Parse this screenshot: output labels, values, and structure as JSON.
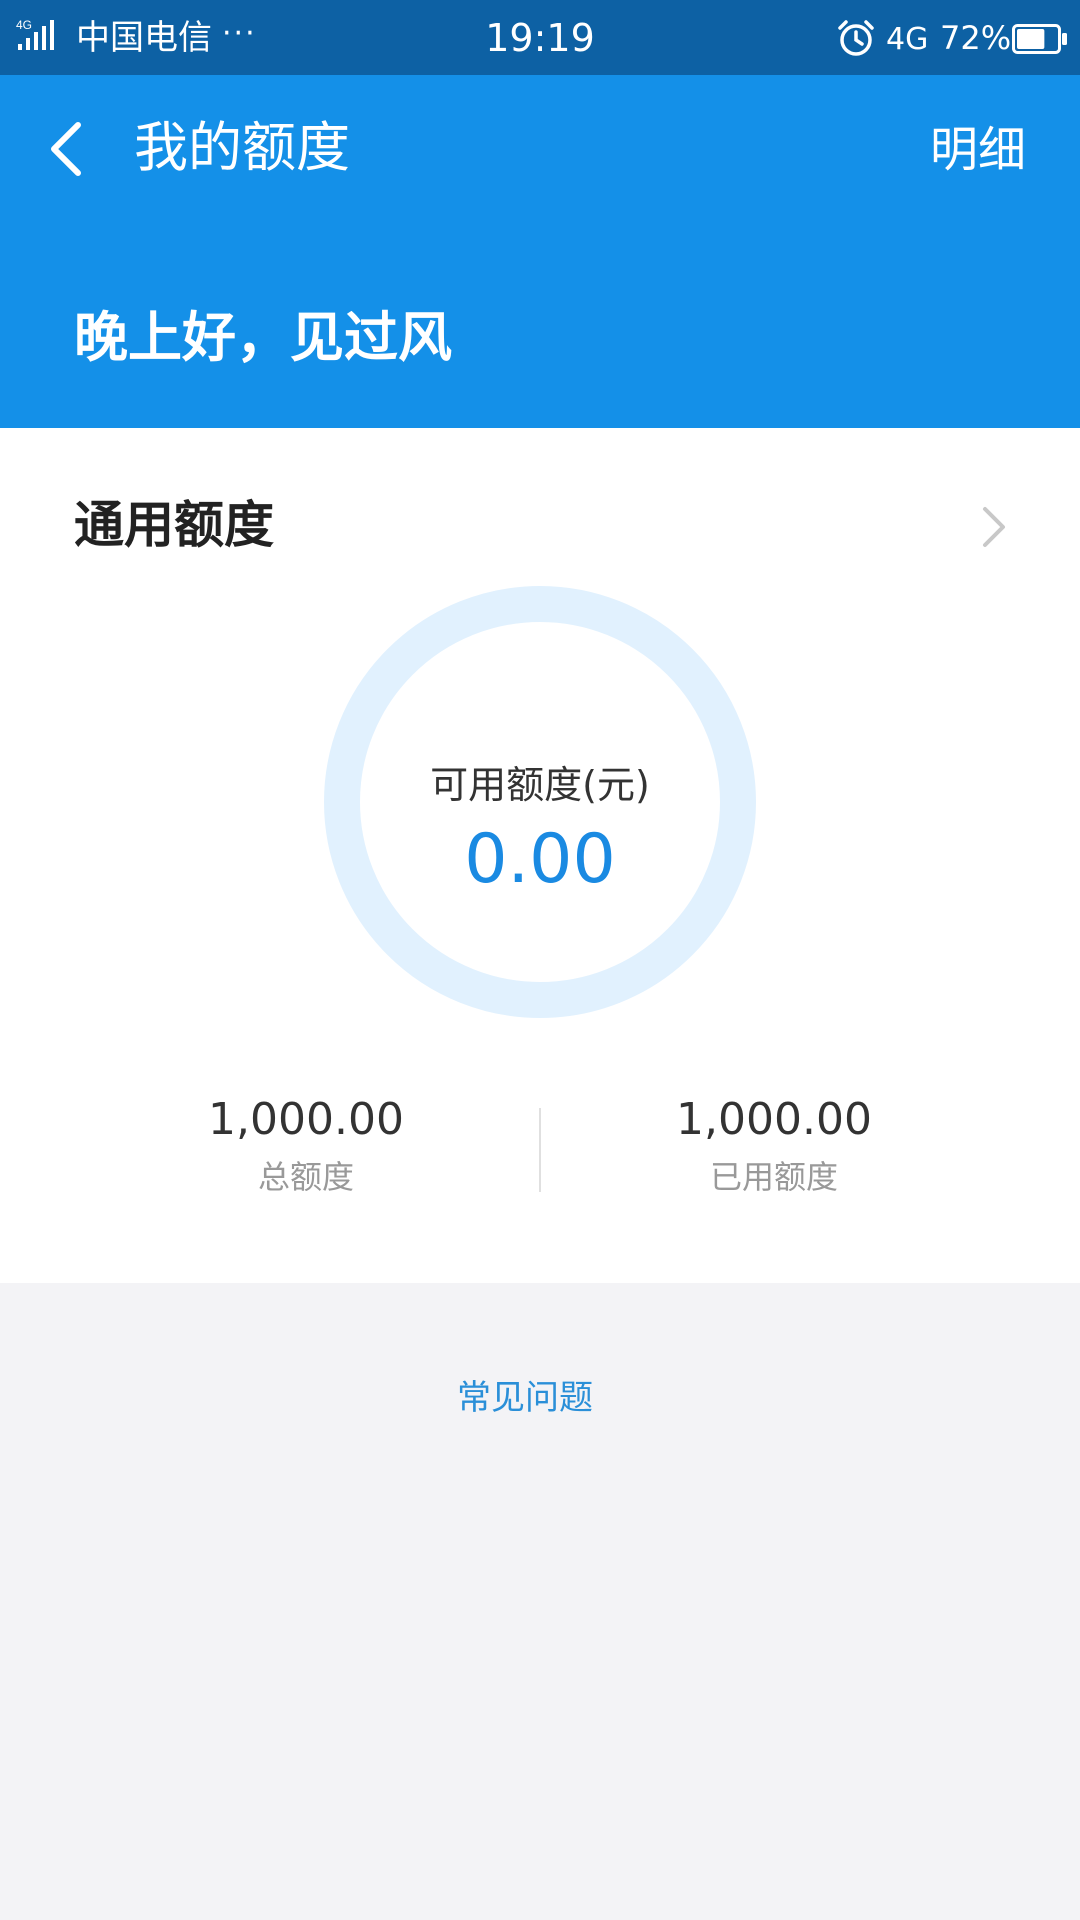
{
  "status_bar": {
    "network_badge": "4G",
    "carrier": "中国电信",
    "more": "···",
    "time": "19:19",
    "network": "4G",
    "battery": "72%",
    "battery_level": 0.72,
    "icons": [
      "signal-icon",
      "alarm-icon",
      "battery-icon"
    ]
  },
  "header": {
    "title": "我的额度",
    "detail_link": "明细",
    "greeting": "晚上好，见过风",
    "back_icon": "chevron-left-icon"
  },
  "credit": {
    "section_title": "通用额度",
    "section_icon": "chevron-right-icon",
    "available_label": "可用额度(元)",
    "available_value": "0.00",
    "total_value": "1,000.00",
    "total_label": "总额度",
    "used_value": "1,000.00",
    "used_label": "已用额度"
  },
  "footer": {
    "faq_link": "常见问题"
  },
  "colors": {
    "status_bar": "#0d61a4",
    "header": "#1490e8",
    "accent": "#1a8ae2",
    "ring": "#e1f1fe",
    "background": "#f3f3f6"
  }
}
